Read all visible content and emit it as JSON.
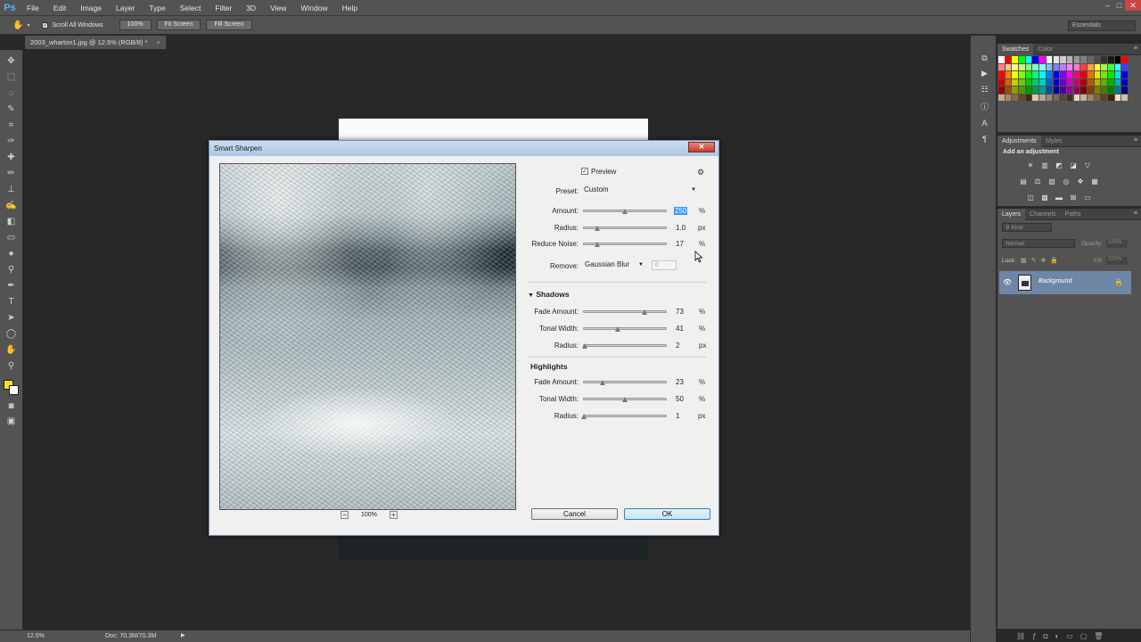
{
  "app": {
    "logo": "Ps",
    "menu": [
      "File",
      "Edit",
      "Image",
      "Layer",
      "Type",
      "Select",
      "Filter",
      "3D",
      "View",
      "Window",
      "Help"
    ],
    "window_controls": {
      "minimize": "–",
      "maximize": "□",
      "close": "✕"
    }
  },
  "options_bar": {
    "scroll_all_windows": "Scroll All Windows",
    "zoom_100": "100%",
    "fit_screen": "Fit Screen",
    "fill_screen": "Fill Screen",
    "workspace": "Essentials"
  },
  "document_tab": {
    "title": "2003_wharton1.jpg @ 12.5% (RGB/8) *",
    "close": "×"
  },
  "status_bar": {
    "zoom": "12.5%",
    "doc": "Doc: 70.3M/70.3M",
    "arrow": "▶"
  },
  "panels": {
    "swatches_tabs": [
      "Swatches",
      "Color"
    ],
    "adjustments_tabs": [
      "Adjustments",
      "Styles"
    ],
    "adjustments_title": "Add an adjustment",
    "layers_tabs": [
      "Layers",
      "Channels",
      "Paths"
    ],
    "layers_kind": "Kind",
    "blend_mode": "Normal",
    "opacity_label": "Opacity:",
    "opacity_value": "100%",
    "lock_label": "Lock:",
    "fill_label": "Fill:",
    "fill_value": "100%",
    "layer_name": "Background",
    "panel_menu": "≡",
    "swatch_colors": [
      "#ffffff",
      "#ff0000",
      "#ffff00",
      "#00ff00",
      "#00ffff",
      "#0000ff",
      "#ff00ff",
      "#ffffff",
      "#e6e6e6",
      "#cccccc",
      "#b3b3b3",
      "#999999",
      "#808080",
      "#666666",
      "#4d4d4d",
      "#333333",
      "#1a1a1a",
      "#000000",
      "#ff0000",
      "#ff8080",
      "#ffbf80",
      "#ffff80",
      "#bfff80",
      "#80ff80",
      "#80ffbf",
      "#80ffff",
      "#80bfff",
      "#8080ff",
      "#bf80ff",
      "#ff80ff",
      "#ff80bf",
      "#ff4040",
      "#ff9f40",
      "#ffff40",
      "#9fff40",
      "#40ff40",
      "#40ffff",
      "#4040ff",
      "#ff0000",
      "#ff8000",
      "#ffff00",
      "#80ff00",
      "#00ff00",
      "#00ff80",
      "#00ffff",
      "#0080ff",
      "#0000ff",
      "#8000ff",
      "#ff00ff",
      "#ff0080",
      "#e60000",
      "#e67300",
      "#e6e600",
      "#73e600",
      "#00e600",
      "#00e6e6",
      "#0000e6",
      "#cc0000",
      "#cc6600",
      "#cccc00",
      "#66cc00",
      "#00cc00",
      "#00cc66",
      "#00cccc",
      "#0066cc",
      "#0000cc",
      "#6600cc",
      "#cc00cc",
      "#cc0066",
      "#b30000",
      "#b35900",
      "#b3b300",
      "#59b300",
      "#00b300",
      "#00b3b3",
      "#0000b3",
      "#990000",
      "#994d00",
      "#999900",
      "#4d9900",
      "#009900",
      "#00994d",
      "#009999",
      "#004d99",
      "#000099",
      "#4d0099",
      "#990099",
      "#99004d",
      "#800000",
      "#804000",
      "#808000",
      "#408000",
      "#008000",
      "#008080",
      "#000080",
      "#c8a888",
      "#a88868",
      "#886848",
      "#684828",
      "#482808",
      "#d8c8b8",
      "#b8a898",
      "#988878",
      "#786858",
      "#584838",
      "#383028",
      "#e8d8c8",
      "#c8b098",
      "#a08060",
      "#806040",
      "#604020",
      "#402000",
      "#f0e0d0",
      "#d0c0b0"
    ]
  },
  "dialog": {
    "title": "Smart Sharpen",
    "close": "✕",
    "preview_label": "Preview",
    "preview_checked": "✓",
    "gear": "⚙",
    "preset_label": "Preset:",
    "preset_value": "Custom",
    "amount_label": "Amount:",
    "amount_value": "250",
    "amount_unit": "%",
    "radius_label": "Radius:",
    "radius_value": "1.0",
    "radius_unit": "px",
    "reduce_noise_label": "Reduce Noise:",
    "reduce_noise_value": "17",
    "reduce_noise_unit": "%",
    "remove_label": "Remove:",
    "remove_value": "Gaussian Blur",
    "remove_angle": "0",
    "shadows_head": "Shadows",
    "shadows_triangle": "▼",
    "sh_fade_label": "Fade Amount:",
    "sh_fade_value": "73",
    "sh_fade_unit": "%",
    "sh_tonal_label": "Tonal Width:",
    "sh_tonal_value": "41",
    "sh_tonal_unit": "%",
    "sh_radius_label": "Radius:",
    "sh_radius_value": "2",
    "sh_radius_unit": "px",
    "highlights_head": "Highlights",
    "hl_fade_label": "Fade Amount:",
    "hl_fade_value": "23",
    "hl_fade_unit": "%",
    "hl_tonal_label": "Tonal Width:",
    "hl_tonal_value": "50",
    "hl_tonal_unit": "%",
    "hl_radius_label": "Radius:",
    "hl_radius_value": "1",
    "hl_radius_unit": "px",
    "zoom_value": "100%",
    "zoom_out": "−",
    "zoom_in": "+",
    "cancel": "Cancel",
    "ok": "OK",
    "slider_levels": {
      "amount": 0.5,
      "radius": 0.17,
      "reduce_noise": 0.17,
      "sh_fade": 0.73,
      "sh_tonal": 0.41,
      "sh_radius": 0.02,
      "hl_fade": 0.23,
      "hl_tonal": 0.5,
      "hl_radius": 0.01
    }
  }
}
